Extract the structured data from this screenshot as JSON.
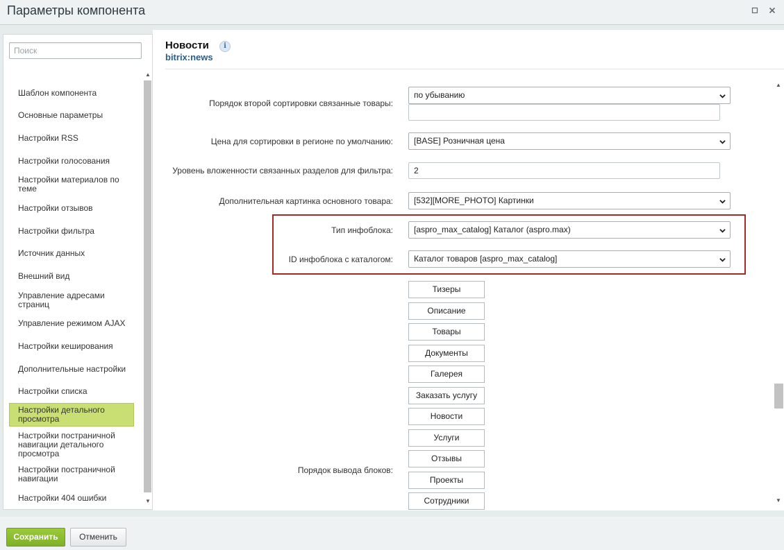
{
  "window": {
    "title": "Параметры компонента"
  },
  "sidebar": {
    "search_placeholder": "Поиск",
    "items": [
      {
        "label": "Шаблон компонента"
      },
      {
        "label": "Основные параметры"
      },
      {
        "label": "Настройки RSS"
      },
      {
        "label": "Настройки голосования"
      },
      {
        "label": "Настройки материалов по теме"
      },
      {
        "label": "Настройки отзывов"
      },
      {
        "label": "Настройки фильтра"
      },
      {
        "label": "Источник данных"
      },
      {
        "label": "Внешний вид"
      },
      {
        "label": "Управление адресами страниц"
      },
      {
        "label": "Управление режимом AJAX"
      },
      {
        "label": "Настройки кеширования"
      },
      {
        "label": "Дополнительные настройки"
      },
      {
        "label": "Настройки списка"
      },
      {
        "label": "Настройки детального просмотра",
        "active": true
      },
      {
        "label": "Настройки постраничной навигации детального просмотра"
      },
      {
        "label": "Настройки постраничной навигации"
      },
      {
        "label": "Настройки 404 ошибки"
      }
    ]
  },
  "component": {
    "title": "Новости",
    "code": "bitrix:news",
    "info_icon": "i"
  },
  "fields": {
    "sort2": {
      "label": "Порядок второй сортировки связанные товары:",
      "value": "по убыванию",
      "extra_value": ""
    },
    "price": {
      "label": "Цена для сортировки в регионе по умолчанию:",
      "value": "[BASE] Розничная цена"
    },
    "depth": {
      "label": "Уровень вложенности связанных разделов для фильтра:",
      "value": "2"
    },
    "more_photo": {
      "label": "Дополнительная картинка основного товара:",
      "value": "[532][MORE_PHOTO] Картинки"
    },
    "iblock_type": {
      "label": "Тип инфоблока:",
      "value": "[aspro_max_catalog] Каталог (aspro.max)"
    },
    "iblock_id": {
      "label": "ID инфоблока с каталогом:",
      "value": "Каталог товаров [aspro_max_catalog]"
    },
    "blocks_order": {
      "label": "Порядок вывода блоков:",
      "items": [
        "Тизеры",
        "Описание",
        "Товары",
        "Документы",
        "Галерея",
        "Заказать услугу",
        "Новости",
        "Услуги",
        "Отзывы",
        "Проекты",
        "Сотрудники"
      ]
    }
  },
  "footer": {
    "save_label": "Сохранить",
    "cancel_label": "Отменить"
  },
  "icons": {
    "maximize": "maximize-icon",
    "close": "close-icon",
    "dropdown": "chevron-down-icon"
  },
  "colors": {
    "active_item": "#c9df74",
    "save_button": "#8bbd30",
    "highlight_border": "#a52a25",
    "component_code": "#2b5d8c"
  }
}
